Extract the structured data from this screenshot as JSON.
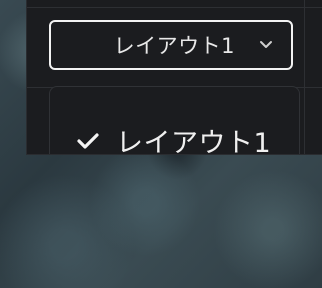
{
  "layout_select": {
    "value": "レイアウト1",
    "chevron_icon": "chevron-down-icon"
  },
  "layout_menu": {
    "items": [
      {
        "label": "レイアウト1",
        "selected": true,
        "icon": "check-icon"
      }
    ]
  },
  "colors": {
    "panel": "#1b1c1f",
    "border": "#f2f2f2",
    "text": "#f0f0f0"
  }
}
